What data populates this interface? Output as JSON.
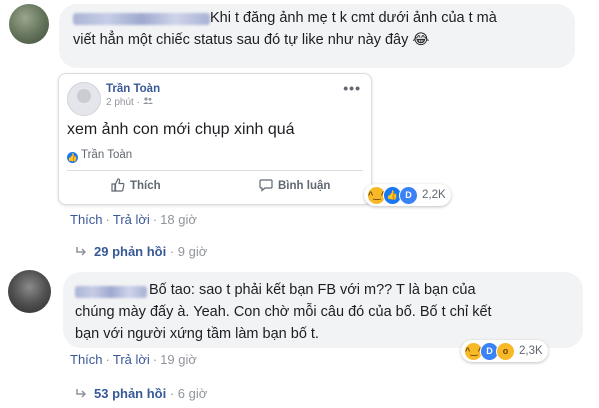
{
  "comment1": {
    "line1": "Khi t đăng ảnh mẹ t k cmt dưới ảnh của t mà",
    "line2": "viết hẳn một chiếc status sau đó tự like như này đây",
    "line2_emoji": "😂",
    "shared_post": {
      "author": "Trần Toàn",
      "time": "2 phút",
      "audience_icon": "friends-icon",
      "body": "xem ảnh con mới chụp xinh quá",
      "liked_by": "Trần Toàn",
      "like_button": "Thích",
      "comment_button": "Bình luận"
    },
    "reactions": {
      "types": [
        "haha",
        "like",
        "love"
      ],
      "count": "2,2K"
    },
    "actions": {
      "like": "Thích",
      "reply": "Trả lời",
      "time": "18 giờ"
    },
    "replies": {
      "label": "29 phản hồi",
      "time": "9 giờ"
    }
  },
  "comment2": {
    "line1": "Bố tao: sao t phải kết bạn FB với m?? T là bạn của",
    "line2": "chúng mày đấy à. Yeah. Con chờ mỗi câu đó của bố. Bố t chỉ kết",
    "line3": "bạn với người xứng tầm làm bạn bố t.",
    "reactions": {
      "types": [
        "haha",
        "like",
        "wow"
      ],
      "count": "2,3K"
    },
    "actions": {
      "like": "Thích",
      "reply": "Trả lời",
      "time": "19 giờ"
    },
    "replies": {
      "label": "53 phản hồi",
      "time": "6 giờ"
    }
  },
  "colors": {
    "link": "#385898",
    "muted": "#90949c",
    "bubble": "#f2f3f5",
    "accent": "#1877f2"
  }
}
